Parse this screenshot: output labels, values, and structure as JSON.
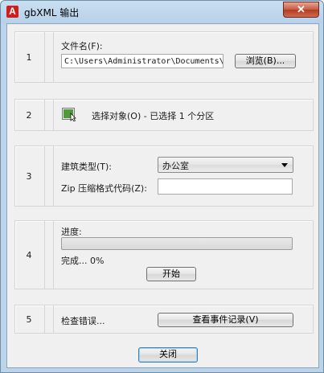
{
  "window": {
    "title": "gbXML 输出",
    "app_icon_letter": "A",
    "close_glyph": "✕"
  },
  "sections": {
    "s1": {
      "number": "1",
      "file_label": "文件名(F):",
      "file_path": "C:\\Users\\Administrator\\Documents\\",
      "browse_label": "浏览(B)..."
    },
    "s2": {
      "number": "2",
      "select_text": "选择对象(O) - 已选择 1 个分区",
      "select_icon": "select-objects-icon"
    },
    "s3": {
      "number": "3",
      "building_type_label": "建筑类型(T):",
      "building_type_value": "办公室",
      "zip_label": "Zip 压缩格式代码(Z):",
      "zip_value": ""
    },
    "s4": {
      "number": "4",
      "progress_label": "进度:",
      "progress_fraction": 0,
      "status_text": "完成... 0%",
      "start_label": "开始"
    },
    "s5": {
      "number": "5",
      "check_label": "检查错误...",
      "view_log_label": "查看事件记录(V)"
    }
  },
  "footer": {
    "close_label": "关闭"
  },
  "colors": {
    "progress_fill": "#06b025",
    "title_bar": "#c9dff1",
    "close_button": "#c75b43"
  }
}
